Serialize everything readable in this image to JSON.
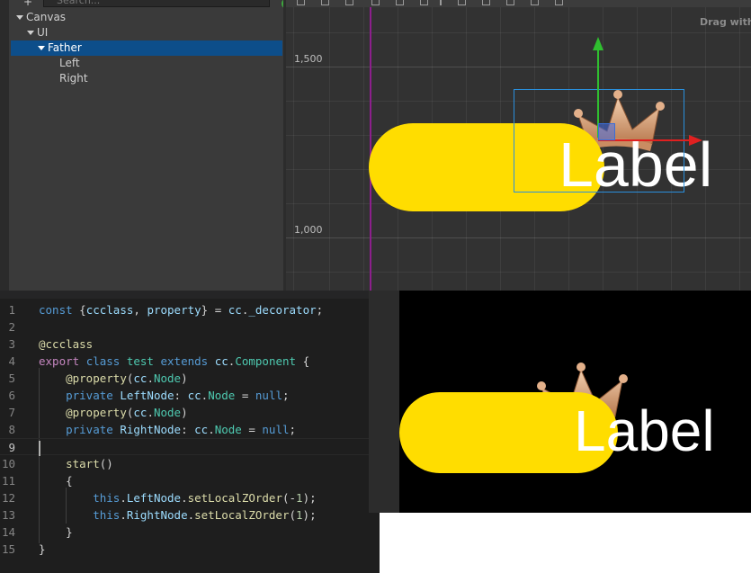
{
  "hierarchy": {
    "search_placeholder": "Search...",
    "items": [
      {
        "label": "Canvas",
        "expanded": true
      },
      {
        "label": "UI",
        "expanded": true
      },
      {
        "label": "Father",
        "expanded": true,
        "selected": true
      },
      {
        "label": "Left"
      },
      {
        "label": "Right"
      }
    ]
  },
  "scene": {
    "hint": "Drag with",
    "ruler_labels": [
      "1,500",
      "1,000"
    ],
    "label_text": "Label",
    "colors": {
      "pill": "#ffdd00",
      "background": "#323232",
      "guide": "#8c1f8c",
      "selection": "#2a8fdc",
      "axis_x": "#e02020",
      "axis_y": "#2fbf2f"
    }
  },
  "code": {
    "lines": [
      {
        "n": "1",
        "tokens": [
          [
            "k",
            "const"
          ],
          [
            "p",
            " {"
          ],
          [
            "id",
            "ccclass"
          ],
          [
            "p",
            ", "
          ],
          [
            "id",
            "property"
          ],
          [
            "p",
            "} = "
          ],
          [
            "id",
            "cc"
          ],
          [
            "p",
            "."
          ],
          [
            "id",
            "_decorator"
          ],
          [
            "p",
            ";"
          ]
        ]
      },
      {
        "n": "2",
        "tokens": []
      },
      {
        "n": "3",
        "tokens": [
          [
            "dec",
            "@ccclass"
          ]
        ]
      },
      {
        "n": "4",
        "tokens": [
          [
            "k2",
            "export"
          ],
          [
            "p",
            " "
          ],
          [
            "k",
            "class"
          ],
          [
            "p",
            " "
          ],
          [
            "ty",
            "test"
          ],
          [
            "p",
            " "
          ],
          [
            "k",
            "extends"
          ],
          [
            "p",
            " "
          ],
          [
            "id",
            "cc"
          ],
          [
            "p",
            "."
          ],
          [
            "ty",
            "Component"
          ],
          [
            "p",
            " {"
          ]
        ]
      },
      {
        "n": "5",
        "tokens": [
          [
            "p",
            "    "
          ],
          [
            "dec",
            "@property"
          ],
          [
            "p",
            "("
          ],
          [
            "id",
            "cc"
          ],
          [
            "p",
            "."
          ],
          [
            "ty",
            "Node"
          ],
          [
            "p",
            ")"
          ]
        ]
      },
      {
        "n": "6",
        "tokens": [
          [
            "p",
            "    "
          ],
          [
            "k",
            "private"
          ],
          [
            "p",
            " "
          ],
          [
            "id",
            "LeftNode"
          ],
          [
            "p",
            ": "
          ],
          [
            "id",
            "cc"
          ],
          [
            "p",
            "."
          ],
          [
            "ty",
            "Node"
          ],
          [
            "p",
            " = "
          ],
          [
            "k",
            "null"
          ],
          [
            "p",
            ";"
          ]
        ]
      },
      {
        "n": "7",
        "tokens": [
          [
            "p",
            "    "
          ],
          [
            "dec",
            "@property"
          ],
          [
            "p",
            "("
          ],
          [
            "id",
            "cc"
          ],
          [
            "p",
            "."
          ],
          [
            "ty",
            "Node"
          ],
          [
            "p",
            ")"
          ]
        ]
      },
      {
        "n": "8",
        "tokens": [
          [
            "p",
            "    "
          ],
          [
            "k",
            "private"
          ],
          [
            "p",
            " "
          ],
          [
            "id",
            "RightNode"
          ],
          [
            "p",
            ": "
          ],
          [
            "id",
            "cc"
          ],
          [
            "p",
            "."
          ],
          [
            "ty",
            "Node"
          ],
          [
            "p",
            " = "
          ],
          [
            "k",
            "null"
          ],
          [
            "p",
            ";"
          ]
        ]
      },
      {
        "n": "9",
        "tokens": [],
        "active": true
      },
      {
        "n": "10",
        "tokens": [
          [
            "p",
            "    "
          ],
          [
            "fn",
            "start"
          ],
          [
            "p",
            "()"
          ]
        ]
      },
      {
        "n": "11",
        "tokens": [
          [
            "p",
            "    {"
          ]
        ]
      },
      {
        "n": "12",
        "tokens": [
          [
            "p",
            "        "
          ],
          [
            "k",
            "this"
          ],
          [
            "p",
            "."
          ],
          [
            "id",
            "LeftNode"
          ],
          [
            "p",
            "."
          ],
          [
            "fn",
            "setLocalZOrder"
          ],
          [
            "p",
            "(-"
          ],
          [
            "num",
            "1"
          ],
          [
            "p",
            ");"
          ]
        ]
      },
      {
        "n": "13",
        "tokens": [
          [
            "p",
            "        "
          ],
          [
            "k",
            "this"
          ],
          [
            "p",
            "."
          ],
          [
            "id",
            "RightNode"
          ],
          [
            "p",
            "."
          ],
          [
            "fn",
            "setLocalZOrder"
          ],
          [
            "p",
            "("
          ],
          [
            "num",
            "1"
          ],
          [
            "p",
            ");"
          ]
        ]
      },
      {
        "n": "14",
        "tokens": [
          [
            "p",
            "    }"
          ]
        ]
      },
      {
        "n": "15",
        "tokens": [
          [
            "p",
            "}"
          ]
        ]
      }
    ]
  },
  "preview": {
    "label_text": "Label",
    "colors": {
      "pill": "#ffdd00",
      "background": "#000000"
    }
  }
}
